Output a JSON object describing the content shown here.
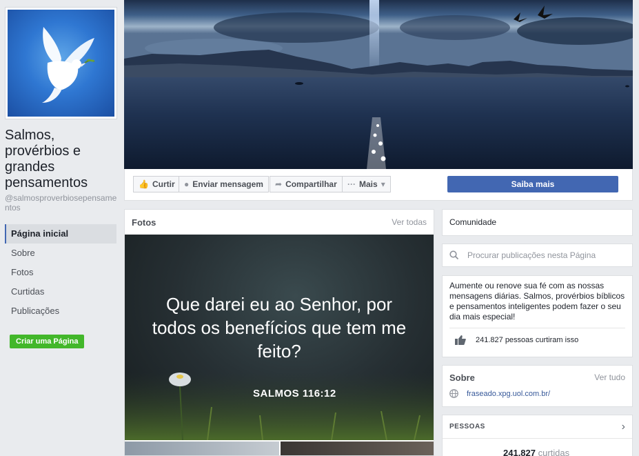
{
  "page": {
    "name": "Salmos, provérbios e grandes pensamentos",
    "handle": "@salmosproverbiosepensamentos"
  },
  "left_nav": {
    "items": [
      {
        "label": "Página inicial",
        "active": true
      },
      {
        "label": "Sobre",
        "active": false
      },
      {
        "label": "Fotos",
        "active": false
      },
      {
        "label": "Curtidas",
        "active": false
      },
      {
        "label": "Publicações",
        "active": false
      }
    ],
    "create_page_label": "Criar uma Página"
  },
  "actions": {
    "like_label": "Curtir",
    "message_label": "Enviar mensagem",
    "share_label": "Compartilhar",
    "more_label": "Mais",
    "cta_label": "Saiba mais"
  },
  "photos": {
    "title": "Fotos",
    "see_all": "Ver todas",
    "quote": "Que darei eu ao Senhor, por todos os benefícios que tem me feito?",
    "reference": "SALMOS 116:12"
  },
  "community": {
    "title": "Comunidade"
  },
  "search": {
    "placeholder": "Procurar publicações nesta Página"
  },
  "description": {
    "text": "Aumente ou renove sua fé com as nossas mensagens diárias. Salmos, provérbios bíblicos e pensamentos inteligentes podem fazer o seu dia mais especial!",
    "likes_text": "241.827 pessoas curtiram isso"
  },
  "about": {
    "title": "Sobre",
    "see_all": "Ver tudo",
    "website": "fraseado.xpg.uol.com.br/"
  },
  "people": {
    "title": "PESSOAS",
    "count": "241.827",
    "count_label": "curtidas"
  },
  "colors": {
    "brand_blue": "#4267b2",
    "create_green": "#42b72a",
    "link_blue": "#365899"
  }
}
